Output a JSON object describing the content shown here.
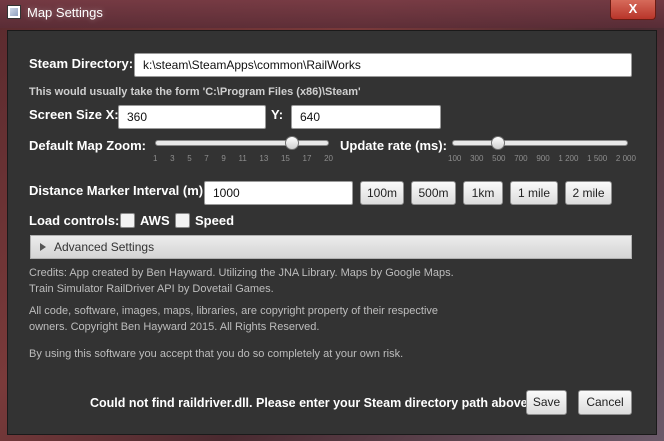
{
  "window": {
    "title": "Map Settings",
    "close_glyph": "X",
    "icon": "app-icon"
  },
  "steam": {
    "label": "Steam Directory:",
    "value": "k:\\steam\\SteamApps\\common\\RailWorks",
    "hint": "This would usually take the form 'C:\\Program Files (x86)\\Steam'"
  },
  "screen": {
    "x_label": "Screen Size X:",
    "x_value": "360",
    "y_label": "Y:",
    "y_value": "640"
  },
  "zoom": {
    "label": "Default Map Zoom:",
    "ticks": [
      "1",
      "3",
      "5",
      "7",
      "9",
      "11",
      "13",
      "15",
      "17",
      "20"
    ],
    "min": 1,
    "max": 20,
    "value": 16
  },
  "update_rate": {
    "label": "Update rate (ms):",
    "ticks": [
      "100",
      "300",
      "500",
      "700",
      "900",
      "1 200",
      "1 500",
      "2 000"
    ],
    "value_fraction": 0.26
  },
  "distance": {
    "label": "Distance Marker Interval (m):",
    "value": "1000",
    "presets": [
      "100m",
      "500m",
      "1km",
      "1 mile",
      "2 mile"
    ]
  },
  "load_controls": {
    "label": "Load controls:",
    "aws": "AWS",
    "speed": "Speed"
  },
  "advanced": {
    "label": "Advanced Settings"
  },
  "credits": {
    "line1": "Credits: App created by Ben Hayward. Utilizing the JNA Library. Maps by Google Maps.",
    "line2": "Train Simulator RailDriver API by Dovetail Games.",
    "line3": "All code, software, images, maps, libraries, are copyright property of their respective",
    "line4": "owners. Copyright Ben Hayward 2015. All Rights Reserved.",
    "line5": "By using this software you accept that you do so completely at your own risk."
  },
  "status": {
    "message": "Could not find raildriver.dll. Please enter your Steam directory path above."
  },
  "actions": {
    "save": "Save",
    "cancel": "Cancel"
  },
  "colors": {
    "panel": "#333333",
    "text": "#ffffff",
    "title_bar": "#7a3a44",
    "close": "#c7443a"
  }
}
